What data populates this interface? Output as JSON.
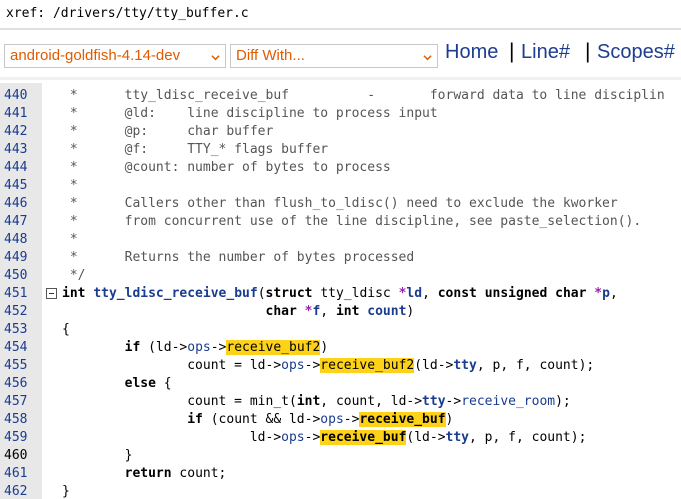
{
  "xref_path": "xref: /drivers/tty/tty_buffer.c",
  "toolbar": {
    "branch_select": "android-goldfish-4.14-dev",
    "diff_select": "Diff With...",
    "home": "Home",
    "line": "Line#",
    "scopes": "Scopes#",
    "separator": "|"
  },
  "icons": {
    "dropdown": "chevron-down-icon",
    "fold": "fold-toggle-icon"
  },
  "colors": {
    "accent_orange": "#e05a00",
    "link_blue": "#1d3d8f",
    "highlight": "#ffd21a",
    "gutter": "#e8e8e8"
  },
  "lines": [
    {
      "n": "440",
      "parts": [
        {
          "t": " *      tty_ldisc_receive_buf          -       forward data to line disciplin",
          "c": "cm"
        }
      ]
    },
    {
      "n": "441",
      "parts": [
        {
          "t": " *      @ld:    line discipline to process input",
          "c": "cm"
        }
      ]
    },
    {
      "n": "442",
      "parts": [
        {
          "t": " *      @p:     char buffer",
          "c": "cm"
        }
      ]
    },
    {
      "n": "443",
      "parts": [
        {
          "t": " *      @f:     TTY_* flags buffer",
          "c": "cm"
        }
      ]
    },
    {
      "n": "444",
      "parts": [
        {
          "t": " *      @count: number of bytes to process",
          "c": "cm"
        }
      ]
    },
    {
      "n": "445",
      "parts": [
        {
          "t": " *",
          "c": "cm"
        }
      ]
    },
    {
      "n": "446",
      "parts": [
        {
          "t": " *      Callers other than flush_to_ldisc() need to exclude the kworker",
          "c": "cm"
        }
      ]
    },
    {
      "n": "447",
      "parts": [
        {
          "t": " *      from concurrent use of the line discipline, see paste_selection().",
          "c": "cm"
        }
      ]
    },
    {
      "n": "448",
      "parts": [
        {
          "t": " *",
          "c": "cm"
        }
      ]
    },
    {
      "n": "449",
      "parts": [
        {
          "t": " *      Returns the number of bytes processed",
          "c": "cm"
        }
      ]
    },
    {
      "n": "450",
      "parts": [
        {
          "t": " */",
          "c": "cm"
        }
      ]
    },
    {
      "n": "451",
      "fold": true,
      "parts": [
        {
          "t": "int ",
          "c": "ty"
        },
        {
          "t": "tty_ldisc_receive_buf",
          "c": "fn"
        },
        {
          "t": "("
        },
        {
          "t": "struct ",
          "c": "kw"
        },
        {
          "t": "tty_ldisc "
        },
        {
          "t": "*",
          "c": "op"
        },
        {
          "t": "ld",
          "c": "memb"
        },
        {
          "t": ", "
        },
        {
          "t": "const unsigned char ",
          "c": "kw"
        },
        {
          "t": "*",
          "c": "op"
        },
        {
          "t": "p",
          "c": "memb"
        },
        {
          "t": ","
        }
      ]
    },
    {
      "n": "452",
      "parts": [
        {
          "t": "                          "
        },
        {
          "t": "char ",
          "c": "kw"
        },
        {
          "t": "*",
          "c": "op"
        },
        {
          "t": "f",
          "c": "memb"
        },
        {
          "t": ", "
        },
        {
          "t": "int ",
          "c": "kw"
        },
        {
          "t": "count",
          "c": "memb"
        },
        {
          "t": ")"
        }
      ]
    },
    {
      "n": "453",
      "parts": [
        {
          "t": "{"
        }
      ]
    },
    {
      "n": "454",
      "parts": [
        {
          "t": "        "
        },
        {
          "t": "if ",
          "c": "kw"
        },
        {
          "t": "(ld->"
        },
        {
          "t": "ops",
          "c": "mem"
        },
        {
          "t": "->"
        },
        {
          "t": "receive_buf2",
          "c": "hl"
        },
        {
          "t": ")"
        }
      ]
    },
    {
      "n": "455",
      "parts": [
        {
          "t": "                count = ld->"
        },
        {
          "t": "ops",
          "c": "mem"
        },
        {
          "t": "->"
        },
        {
          "t": "receive_buf2",
          "c": "hl"
        },
        {
          "t": "(ld->"
        },
        {
          "t": "tty",
          "c": "memb"
        },
        {
          "t": ", p, f, count);"
        }
      ]
    },
    {
      "n": "456",
      "parts": [
        {
          "t": "        "
        },
        {
          "t": "else ",
          "c": "kw"
        },
        {
          "t": "{"
        }
      ]
    },
    {
      "n": "457",
      "parts": [
        {
          "t": "                count = min_t("
        },
        {
          "t": "int",
          "c": "kw"
        },
        {
          "t": ", count, ld->"
        },
        {
          "t": "tty",
          "c": "memb"
        },
        {
          "t": "->"
        },
        {
          "t": "receive_room",
          "c": "mem"
        },
        {
          "t": ");"
        }
      ]
    },
    {
      "n": "458",
      "parts": [
        {
          "t": "                "
        },
        {
          "t": "if ",
          "c": "kw"
        },
        {
          "t": "(count && ld->"
        },
        {
          "t": "ops",
          "c": "mem"
        },
        {
          "t": "->"
        },
        {
          "t": "receive_buf",
          "c": "hlb"
        },
        {
          "t": ")"
        }
      ]
    },
    {
      "n": "459",
      "parts": [
        {
          "t": "                        ld->"
        },
        {
          "t": "ops",
          "c": "mem"
        },
        {
          "t": "->"
        },
        {
          "t": "receive_buf",
          "c": "hlb"
        },
        {
          "t": "(ld->"
        },
        {
          "t": "tty",
          "c": "memb"
        },
        {
          "t": ", p, f, count);"
        }
      ]
    },
    {
      "n": "460",
      "current": true,
      "parts": [
        {
          "t": "        }"
        }
      ]
    },
    {
      "n": "461",
      "parts": [
        {
          "t": "        "
        },
        {
          "t": "return ",
          "c": "kw"
        },
        {
          "t": "count;"
        }
      ]
    },
    {
      "n": "462",
      "parts": [
        {
          "t": "}"
        }
      ]
    }
  ]
}
